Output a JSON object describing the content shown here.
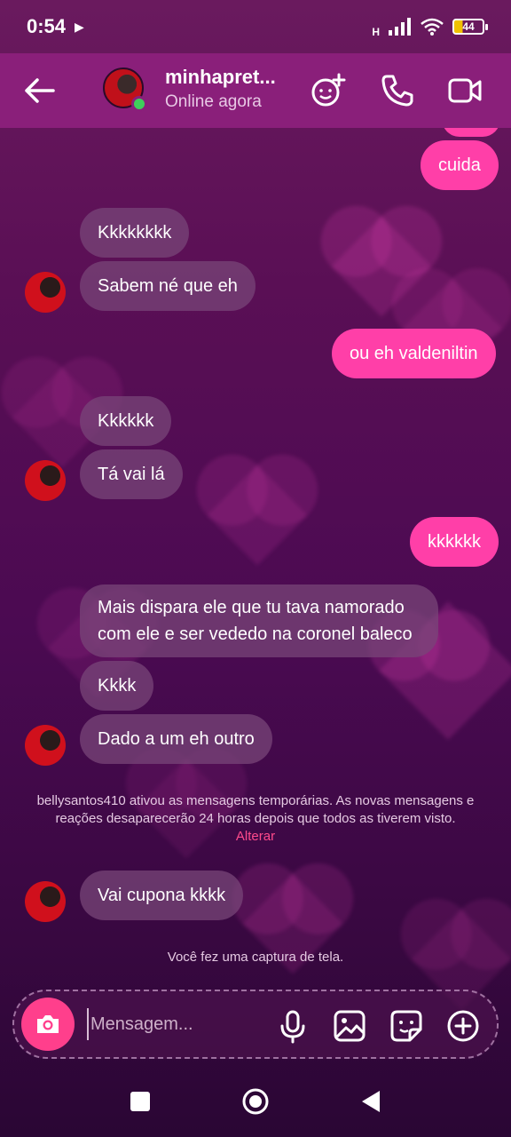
{
  "status": {
    "time": "0:54",
    "network": "H",
    "battery": "44"
  },
  "header": {
    "contact_name": "minhapret...",
    "presence": "Online agora"
  },
  "messages": {
    "m0": "cuida",
    "m1": "Kkkkkkkk",
    "m2": "Sabem né que eh",
    "m3": "ou eh valdeniltin",
    "m4": "Kkkkkk",
    "m5": "Tá vai lá",
    "m6": "kkkkkk",
    "m7": "Mais dispara ele que tu tava namorado com ele e ser vededo na coronel baleco",
    "m8": "Kkkk",
    "m9": "Dado a um eh outro",
    "m10": "Vai cupona kkkk"
  },
  "system": {
    "notice": "bellysantos410 ativou as mensagens temporárias. As novas mensagens e reações desaparecerão 24 horas depois que todos as tiverem visto.",
    "notice_link": "Alterar",
    "screenshot": "Você fez uma captura de tela."
  },
  "composer": {
    "placeholder": "Mensagem..."
  },
  "colors": {
    "header": "#8a1f7a",
    "outgoing": "#ff3fa8",
    "incoming": "#7a4678",
    "accent": "#ff3f8c",
    "online": "#3ecf5b"
  },
  "icons": [
    "back-arrow-icon",
    "effects-icon",
    "phone-icon",
    "video-icon",
    "camera-icon",
    "mic-icon",
    "image-icon",
    "sticker-icon",
    "plus-icon",
    "square-icon",
    "circle-icon",
    "triangle-back-icon"
  ]
}
